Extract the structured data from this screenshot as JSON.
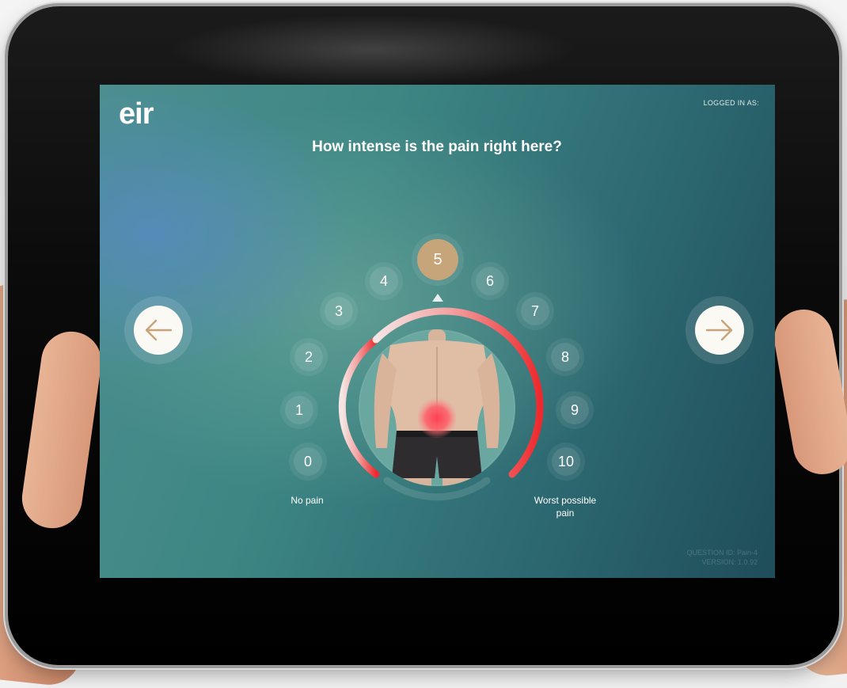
{
  "app": {
    "logo_text": "eir",
    "logged_in_label": "LOGGED IN AS:"
  },
  "question": {
    "text": "How intense is the pain right here?"
  },
  "scale": {
    "values": [
      "0",
      "1",
      "2",
      "3",
      "4",
      "5",
      "6",
      "7",
      "8",
      "9",
      "10"
    ],
    "selected_value": 5,
    "min_label": "No pain",
    "max_label": "Worst possible pain"
  },
  "navigation": {
    "back_icon": "arrow-left-icon",
    "next_icon": "arrow-right-icon"
  },
  "footer": {
    "question_id": "QUESTION ID: Pain-4",
    "version": "VERSION: 1.0.92"
  },
  "colors": {
    "accent_selected": "#c6a57a",
    "arrow_color": "#c8a27a",
    "gauge_start": "#f4dede",
    "gauge_end": "#ee2a2e",
    "screen_background": "#3d8684"
  }
}
